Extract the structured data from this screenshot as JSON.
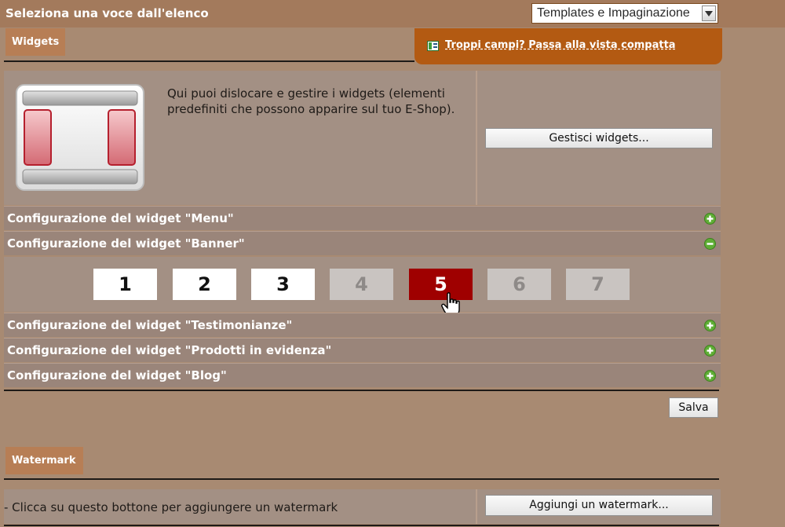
{
  "topbar": {
    "title": "Seleziona una voce dall'elenco",
    "select_value": "Templates e Impaginazione"
  },
  "widgets": {
    "tab_label": "Widgets",
    "compact_link": "Troppi campi? Passa alla vista compatta",
    "description": "Qui puoi dislocare e gestire i widgets (elementi predefiniti che possono apparire sul tuo E-Shop).",
    "manage_button": "Gestisci widgets..."
  },
  "accordion": [
    {
      "label": "Configurazione del widget \"Menu\"",
      "state": "collapsed"
    },
    {
      "label": "Configurazione del widget \"Banner\"",
      "state": "expanded"
    },
    {
      "label": "Configurazione del widget \"Testimonianze\"",
      "state": "collapsed"
    },
    {
      "label": "Configurazione del widget \"Prodotti in evidenza\"",
      "state": "collapsed"
    },
    {
      "label": "Configurazione del widget \"Blog\"",
      "state": "collapsed"
    }
  ],
  "banner_pages": [
    {
      "label": "1",
      "state": "enabled"
    },
    {
      "label": "2",
      "state": "enabled"
    },
    {
      "label": "3",
      "state": "enabled"
    },
    {
      "label": "4",
      "state": "disabled"
    },
    {
      "label": "5",
      "state": "active"
    },
    {
      "label": "6",
      "state": "disabled"
    },
    {
      "label": "7",
      "state": "disabled"
    }
  ],
  "save_button": "Salva",
  "watermark": {
    "tab_label": "Watermark",
    "description": "- Clicca su questo bottone per aggiungere un watermark",
    "add_button": "Aggiungi un watermark..."
  },
  "colors": {
    "page_bg": "#a88a72",
    "topbar_bg": "#a37a5c",
    "tab_bg": "#b77e55",
    "compact_box": "#b35a12",
    "panel_bg": "#a39084",
    "accordion_bg": "#9a857a",
    "active_page": "#9f0000",
    "toggle_green": "#5fae35"
  },
  "icons": {
    "expand": "plus-circle-icon",
    "collapse": "minus-circle-icon",
    "compact_view": "compact-view-icon",
    "layout_illustration": "widget-layout-icon",
    "cursor": "hand-pointer-icon"
  }
}
